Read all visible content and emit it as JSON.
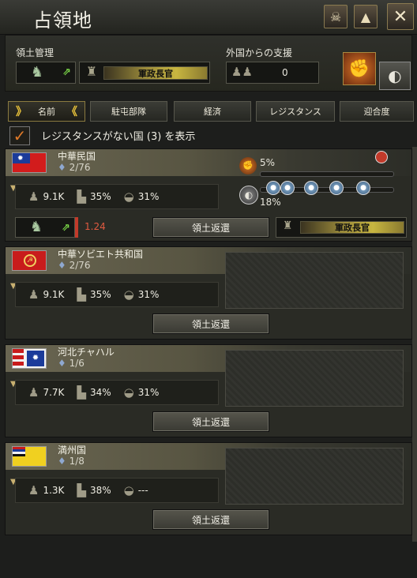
{
  "window": {
    "title": "占領地"
  },
  "management": {
    "territory_label": "領土管理",
    "governor_label": "軍政長官",
    "foreign_support_label": "外国からの支援",
    "foreign_support_value": "0"
  },
  "tabs": [
    {
      "label": "名前",
      "active": true
    },
    {
      "label": "駐屯部隊",
      "active": false
    },
    {
      "label": "経済",
      "active": false
    },
    {
      "label": "レジスタンス",
      "active": false
    },
    {
      "label": "迎合度",
      "active": false
    }
  ],
  "filter": {
    "label": "レジスタンスがない国 (3) を表示",
    "checked": true
  },
  "countries": [
    {
      "name": "中華民国",
      "states": "2/76",
      "manpower": "9.1K",
      "factories": "35%",
      "resistance": "31%",
      "resistance_pct": "5%",
      "compliance_pct": "18%",
      "garrison_value": "1.24",
      "governor_label": "軍政長官",
      "return_label": "領土返還"
    },
    {
      "name": "中華ソビエト共和国",
      "states": "2/76",
      "manpower": "9.1K",
      "factories": "35%",
      "resistance": "31%",
      "return_label": "領土返還"
    },
    {
      "name": "河北チャハル",
      "states": "1/6",
      "manpower": "7.7K",
      "factories": "34%",
      "resistance": "31%",
      "return_label": "領土返還"
    },
    {
      "name": "満州国",
      "states": "1/8",
      "manpower": "1.3K",
      "factories": "38%",
      "resistance": "---",
      "return_label": "領土返還"
    }
  ],
  "colors": {
    "accent": "#e9c23a",
    "resistance_fill": "#c23a2a",
    "check": "#e07a28"
  }
}
